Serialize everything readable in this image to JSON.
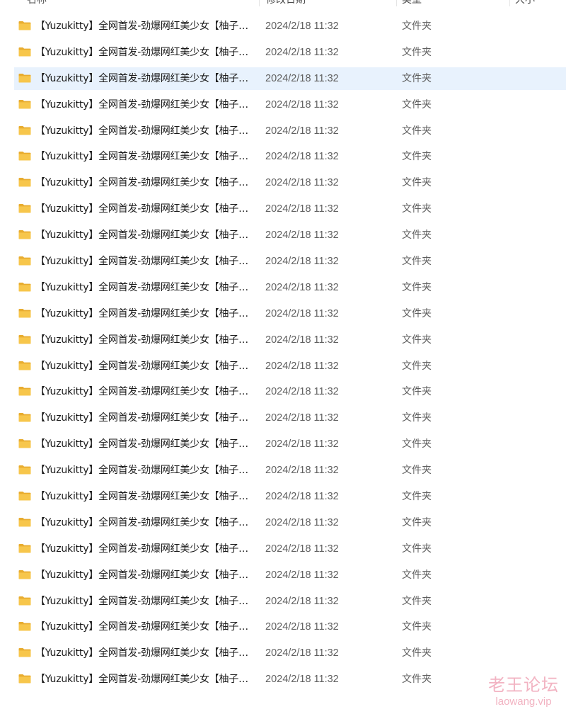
{
  "header": {
    "col_name": "名称",
    "col_date": "修改日期",
    "col_type": "类型",
    "col_size": "大小"
  },
  "rows": [
    {
      "name": "【Yuzukitty】全网首发-劲爆网红美少女【柚子猫】",
      "date": "2024/2/18 11:32",
      "type": "文件夹"
    },
    {
      "name": "【Yuzukitty】全网首发-劲爆网红美少女【柚子猫】",
      "date": "2024/2/18 11:32",
      "type": "文件夹"
    },
    {
      "name": "【Yuzukitty】全网首发-劲爆网红美少女【柚子猫】",
      "date": "2024/2/18 11:32",
      "type": "文件夹"
    },
    {
      "name": "【Yuzukitty】全网首发-劲爆网红美少女【柚子猫】",
      "date": "2024/2/18 11:32",
      "type": "文件夹"
    },
    {
      "name": "【Yuzukitty】全网首发-劲爆网红美少女【柚子猫】",
      "date": "2024/2/18 11:32",
      "type": "文件夹"
    },
    {
      "name": "【Yuzukitty】全网首发-劲爆网红美少女【柚子猫】",
      "date": "2024/2/18 11:32",
      "type": "文件夹"
    },
    {
      "name": "【Yuzukitty】全网首发-劲爆网红美少女【柚子猫】",
      "date": "2024/2/18 11:32",
      "type": "文件夹"
    },
    {
      "name": "【Yuzukitty】全网首发-劲爆网红美少女【柚子猫】",
      "date": "2024/2/18 11:32",
      "type": "文件夹"
    },
    {
      "name": "【Yuzukitty】全网首发-劲爆网红美少女【柚子猫】",
      "date": "2024/2/18 11:32",
      "type": "文件夹"
    },
    {
      "name": "【Yuzukitty】全网首发-劲爆网红美少女【柚子猫】",
      "date": "2024/2/18 11:32",
      "type": "文件夹"
    },
    {
      "name": "【Yuzukitty】全网首发-劲爆网红美少女【柚子猫】",
      "date": "2024/2/18 11:32",
      "type": "文件夹"
    },
    {
      "name": "【Yuzukitty】全网首发-劲爆网红美少女【柚子猫】",
      "date": "2024/2/18 11:32",
      "type": "文件夹"
    },
    {
      "name": "【Yuzukitty】全网首发-劲爆网红美少女【柚子猫】",
      "date": "2024/2/18 11:32",
      "type": "文件夹"
    },
    {
      "name": "【Yuzukitty】全网首发-劲爆网红美少女【柚子猫】",
      "date": "2024/2/18 11:32",
      "type": "文件夹"
    },
    {
      "name": "【Yuzukitty】全网首发-劲爆网红美少女【柚子猫】",
      "date": "2024/2/18 11:32",
      "type": "文件夹"
    },
    {
      "name": "【Yuzukitty】全网首发-劲爆网红美少女【柚子猫】",
      "date": "2024/2/18 11:32",
      "type": "文件夹"
    },
    {
      "name": "【Yuzukitty】全网首发-劲爆网红美少女【柚子猫】",
      "date": "2024/2/18 11:32",
      "type": "文件夹"
    },
    {
      "name": "【Yuzukitty】全网首发-劲爆网红美少女【柚子猫】",
      "date": "2024/2/18 11:32",
      "type": "文件夹"
    },
    {
      "name": "【Yuzukitty】全网首发-劲爆网红美少女【柚子猫】",
      "date": "2024/2/18 11:32",
      "type": "文件夹"
    },
    {
      "name": "【Yuzukitty】全网首发-劲爆网红美少女【柚子猫】",
      "date": "2024/2/18 11:32",
      "type": "文件夹"
    },
    {
      "name": "【Yuzukitty】全网首发-劲爆网红美少女【柚子猫】",
      "date": "2024/2/18 11:32",
      "type": "文件夹"
    },
    {
      "name": "【Yuzukitty】全网首发-劲爆网红美少女【柚子猫】",
      "date": "2024/2/18 11:32",
      "type": "文件夹"
    },
    {
      "name": "【Yuzukitty】全网首发-劲爆网红美少女【柚子猫】",
      "date": "2024/2/18 11:32",
      "type": "文件夹"
    },
    {
      "name": "【Yuzukitty】全网首发-劲爆网红美少女【柚子猫】",
      "date": "2024/2/18 11:32",
      "type": "文件夹"
    },
    {
      "name": "【Yuzukitty】全网首发-劲爆网红美少女【柚子猫】",
      "date": "2024/2/18 11:32",
      "type": "文件夹"
    },
    {
      "name": "【Yuzukitty】全网首发-劲爆网红美少女【柚子猫】",
      "date": "2024/2/18 11:32",
      "type": "文件夹"
    }
  ],
  "selected_row": 2,
  "colors": {
    "selection": "#e8f2fd",
    "folder": "#f7c64b",
    "watermark": "#f2b3c2"
  },
  "icon": "folder-icon",
  "watermark": {
    "line1": "老王论坛",
    "line2": "laowang.vip"
  }
}
